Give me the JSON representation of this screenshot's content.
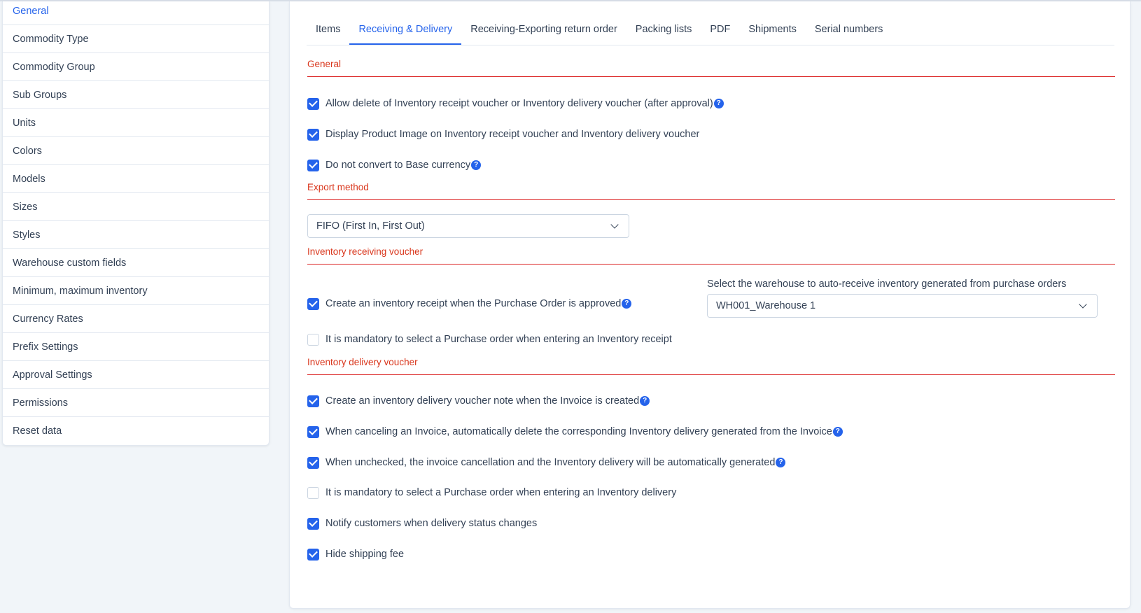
{
  "sidebar": {
    "items": [
      {
        "label": "General",
        "active": true
      },
      {
        "label": "Commodity Type"
      },
      {
        "label": "Commodity Group"
      },
      {
        "label": "Sub Groups"
      },
      {
        "label": "Units"
      },
      {
        "label": "Colors"
      },
      {
        "label": "Models"
      },
      {
        "label": "Sizes"
      },
      {
        "label": "Styles"
      },
      {
        "label": "Warehouse custom fields"
      },
      {
        "label": "Minimum, maximum inventory"
      },
      {
        "label": "Currency Rates"
      },
      {
        "label": "Prefix Settings"
      },
      {
        "label": "Approval Settings"
      },
      {
        "label": "Permissions"
      },
      {
        "label": "Reset data"
      }
    ]
  },
  "tabs": [
    {
      "label": "Items"
    },
    {
      "label": "Receiving & Delivery",
      "active": true
    },
    {
      "label": "Receiving-Exporting return order"
    },
    {
      "label": "Packing lists"
    },
    {
      "label": "PDF"
    },
    {
      "label": "Shipments"
    },
    {
      "label": "Serial numbers"
    }
  ],
  "help_glyph": "?",
  "sections": {
    "general": {
      "title": "General",
      "options": [
        {
          "label": "Allow delete of Inventory receipt voucher or Inventory delivery voucher (after approval)",
          "checked": true,
          "help": true
        },
        {
          "label": "Display Product Image on Inventory receipt voucher and Inventory delivery voucher",
          "checked": true,
          "help": false
        },
        {
          "label": "Do not convert to Base currency",
          "checked": true,
          "help": true
        }
      ]
    },
    "export_method": {
      "title": "Export method",
      "selected": "FIFO (First In, First Out)"
    },
    "receiving": {
      "title": "Inventory receiving voucher",
      "options": [
        {
          "label": "Create an inventory receipt when the Purchase Order is approved",
          "checked": true,
          "help": true
        },
        {
          "label": "It is mandatory to select a Purchase order when entering an Inventory receipt",
          "checked": false,
          "help": false
        }
      ],
      "warehouse_label": "Select the warehouse to auto-receive inventory generated from purchase orders",
      "warehouse_selected": "WH001_Warehouse 1"
    },
    "delivery": {
      "title": "Inventory delivery voucher",
      "options": [
        {
          "label": "Create an inventory delivery voucher note when the Invoice is created",
          "checked": true,
          "help": true
        },
        {
          "label": "When canceling an Invoice, automatically delete the corresponding Inventory delivery generated from the Invoice",
          "checked": true,
          "help": true
        },
        {
          "label": "When unchecked, the invoice cancellation and the Inventory delivery will be automatically generated",
          "checked": true,
          "help": true
        },
        {
          "label": "It is mandatory to select a Purchase order when entering an Inventory delivery",
          "checked": false,
          "help": false
        },
        {
          "label": "Notify customers when delivery status changes",
          "checked": true,
          "help": false
        },
        {
          "label": "Hide shipping fee",
          "checked": true,
          "help": false
        }
      ]
    }
  },
  "colors": {
    "accent": "#2563eb",
    "section_title": "#d9361c",
    "section_rule": "#dc2626"
  }
}
